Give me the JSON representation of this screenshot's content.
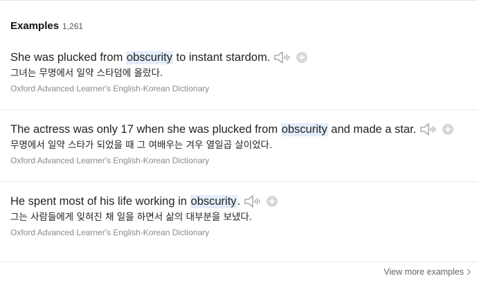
{
  "header": {
    "title": "Examples",
    "count": "1,261"
  },
  "examples": [
    {
      "before": "She was plucked from ",
      "keyword": "obscurity",
      "after": " to instant stardom.",
      "translation": "그녀는 무명에서 일약 스타덤에 올랐다.",
      "source": "Oxford Advanced Learner's English-Korean Dictionary"
    },
    {
      "before": "The actress was only 17 when she was plucked from ",
      "keyword": "obscurity",
      "after": " and made a star.",
      "translation": "무명에서 일약 스타가 되었을 때 그 여배우는 겨우 열일곱 살이었다.",
      "source": "Oxford Advanced Learner's English-Korean Dictionary"
    },
    {
      "before": "He spent most of his life working in ",
      "keyword": "obscurity",
      "after": ".",
      "translation": "그는 사람들에게 잊혀진 채 일을 하면서 삶의 대부분을 보냈다.",
      "source": "Oxford Advanced Learner's English-Korean Dictionary"
    }
  ],
  "footer": {
    "more_label": "View more examples"
  },
  "colors": {
    "highlight": "#e3eefb",
    "icon": "#9a9a9a",
    "add_button": "#d7d7d7"
  },
  "icons": {
    "speaker": "speaker-icon",
    "add": "plus-icon",
    "more": "chevron-right-icon"
  }
}
